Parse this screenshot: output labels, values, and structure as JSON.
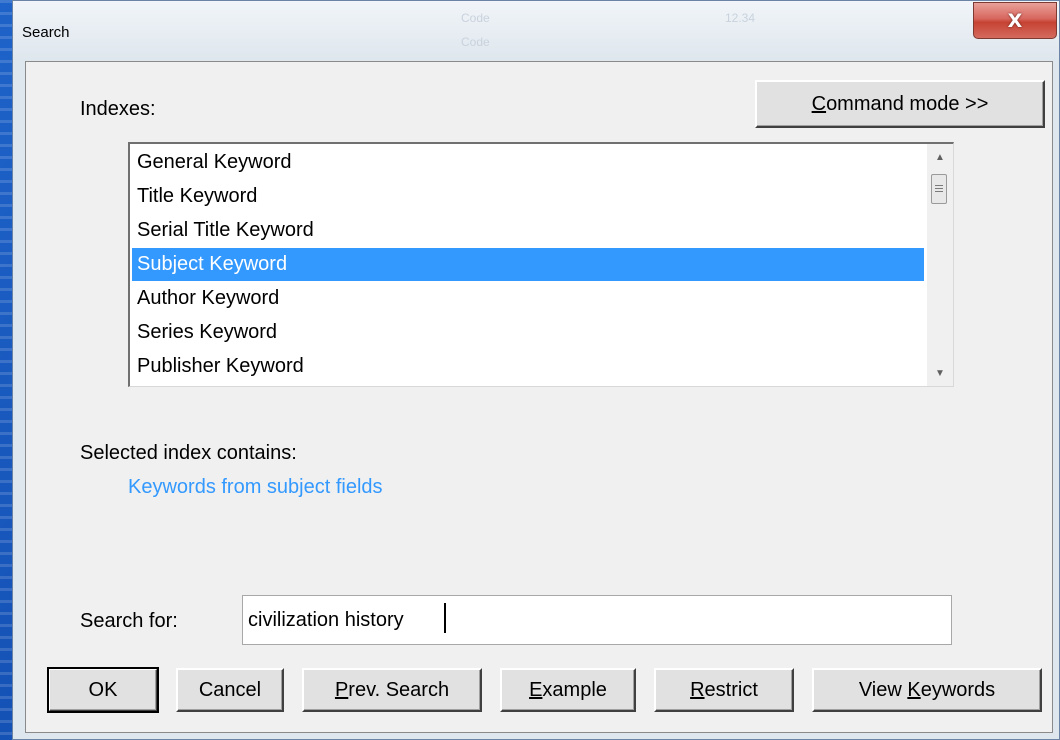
{
  "window": {
    "title": "Search",
    "close_glyph": "X"
  },
  "background_ghost_text": [
    "Code",
    "Code",
    "12.34"
  ],
  "indexes_label": "Indexes:",
  "command_mode": {
    "pre": "",
    "accel": "C",
    "post": "ommand mode >>"
  },
  "index_list": {
    "items": [
      "General Keyword",
      "Title Keyword",
      "Serial Title Keyword",
      "Subject Keyword",
      "Author Keyword",
      "Series Keyword",
      "Publisher Keyword"
    ],
    "selected_index": 3,
    "scroll_up_glyph": "▲",
    "scroll_down_glyph": "▼"
  },
  "selected_index_label": "Selected index contains:",
  "selected_index_description": "Keywords from subject fields",
  "search_for_label": "Search for:",
  "search_value": "civilization history",
  "buttons": {
    "ok": {
      "pre": "OK",
      "accel": "",
      "post": ""
    },
    "cancel": {
      "pre": "Cancel",
      "accel": "",
      "post": ""
    },
    "prev_search": {
      "pre": "",
      "accel": "P",
      "post": "rev. Search"
    },
    "example": {
      "pre": "",
      "accel": "E",
      "post": "xample"
    },
    "restrict": {
      "pre": "",
      "accel": "R",
      "post": "estrict"
    },
    "view_keywords": {
      "pre": "View ",
      "accel": "K",
      "post": "eywords"
    }
  },
  "colors": {
    "selection": "#3399ff",
    "description_text": "#3399ff",
    "desktop_blue": "#1450b4",
    "close_red": "#c64333"
  }
}
